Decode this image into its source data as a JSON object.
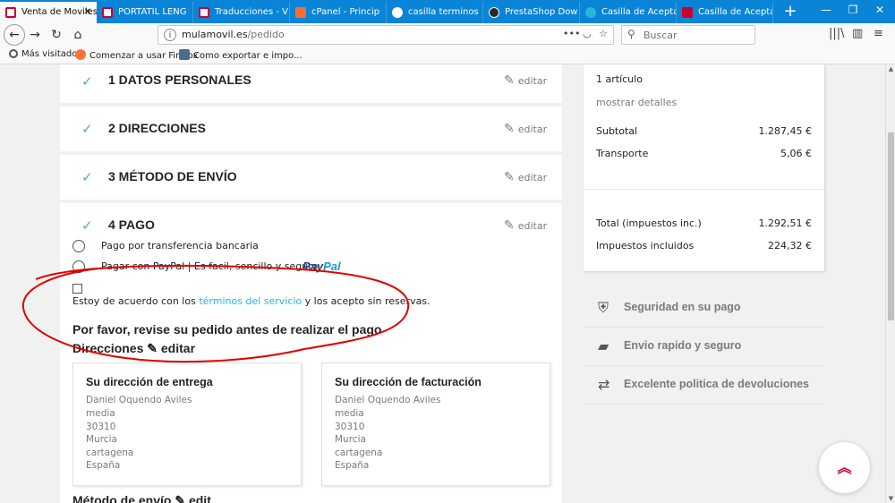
{
  "colors": {
    "tabbar_bg": "#0a84d6",
    "check_green": "#4cbb6c",
    "link_teal": "#24b9d7",
    "annotation_red": "#e00000",
    "paypal_dark": "#253b80",
    "paypal_light": "#179bd7",
    "back_to_top": "#c9002b"
  },
  "tabs": [
    {
      "title": "Venta de Moviles",
      "active": true,
      "favicon": "mulamovil-icon",
      "favicon_color": "#c9002b"
    },
    {
      "title": "PORTATIL LENG",
      "active": false,
      "favicon": "page-icon",
      "favicon_color": "#c9002b"
    },
    {
      "title": "Traducciones - V",
      "active": false,
      "favicon": "page-icon",
      "favicon_color": "#c9002b"
    },
    {
      "title": "cPanel - Princip",
      "active": false,
      "favicon": "cpanel-icon",
      "favicon_color": "#ff6c2c"
    },
    {
      "title": "casilla terminos",
      "active": false,
      "favicon": "google-icon",
      "favicon_color": "#ffffff"
    },
    {
      "title": "PrestaShop Dow",
      "active": false,
      "favicon": "github-icon",
      "favicon_color": "#24292e"
    },
    {
      "title": "Casilla de Acepta",
      "active": false,
      "favicon": "prestashop-icon",
      "favicon_color": "#25b9d7"
    },
    {
      "title": "Casilla de Acepta",
      "active": false,
      "favicon": "u-icon",
      "favicon_color": "#c9002b"
    }
  ],
  "nav": {
    "url_domain": "mulamovil.es",
    "url_path": "/pedido",
    "search_placeholder": "Buscar"
  },
  "bookmarks": [
    {
      "label": "Más visitados",
      "icon": "gear-icon"
    },
    {
      "label": "Comenzar a usar Firefox",
      "icon": "firefox-icon"
    },
    {
      "label": "Como exportar e impo...",
      "icon": "page-icon"
    }
  ],
  "steps": [
    {
      "title": "1 Datos personales",
      "edit": "editar"
    },
    {
      "title": "2 Direcciones",
      "edit": "editar"
    },
    {
      "title": "3 Método de envío",
      "edit": "editar"
    },
    {
      "title": "4 Pago",
      "edit": "editar"
    }
  ],
  "payment": {
    "option_transfer": "Pago por transferencia bancaria",
    "option_paypal": "Pagar con PayPal | Es facil, sencillo y seguro",
    "paypal_logo_a": "Pay",
    "paypal_logo_b": "Pal",
    "terms_before": "Estoy de acuerdo con los ",
    "terms_link": "términos del servicio",
    "terms_after": " y los acepto sin reservas."
  },
  "review": {
    "heading": "Por favor, revise su pedido antes de realizar el pago",
    "addresses_label": "Direcciones",
    "addresses_edit": "editar",
    "delivery": {
      "title": "Su dirección de entrega",
      "lines": [
        "Daniel Oquendo Aviles",
        "media",
        "30310",
        "Murcia",
        "cartagena",
        "España"
      ]
    },
    "billing": {
      "title": "Su dirección de facturación",
      "lines": [
        "Daniel Oquendo Aviles",
        "media",
        "30310",
        "Murcia",
        "cartagena",
        "España"
      ]
    },
    "shipping_label": "Método de envío",
    "shipping_edit": "edit"
  },
  "summary": {
    "items": "1 artículo",
    "details": "mostrar detalles",
    "subtotal_label": "Subtotal",
    "subtotal_value": "1.287,45 €",
    "shipping_label": "Transporte",
    "shipping_value": "5,06 €",
    "total_label": "Total (impuestos inc.)",
    "total_value": "1.292,51 €",
    "taxes_label": "Impuestos incluidos",
    "taxes_value": "224,32 €"
  },
  "reassurance": [
    {
      "label": "Seguridad en su pago",
      "icon": "shield-icon"
    },
    {
      "label": "Envio rapido y seguro",
      "icon": "truck-icon"
    },
    {
      "label": "Excelente politica de devoluciones",
      "icon": "exchange-icon"
    }
  ]
}
